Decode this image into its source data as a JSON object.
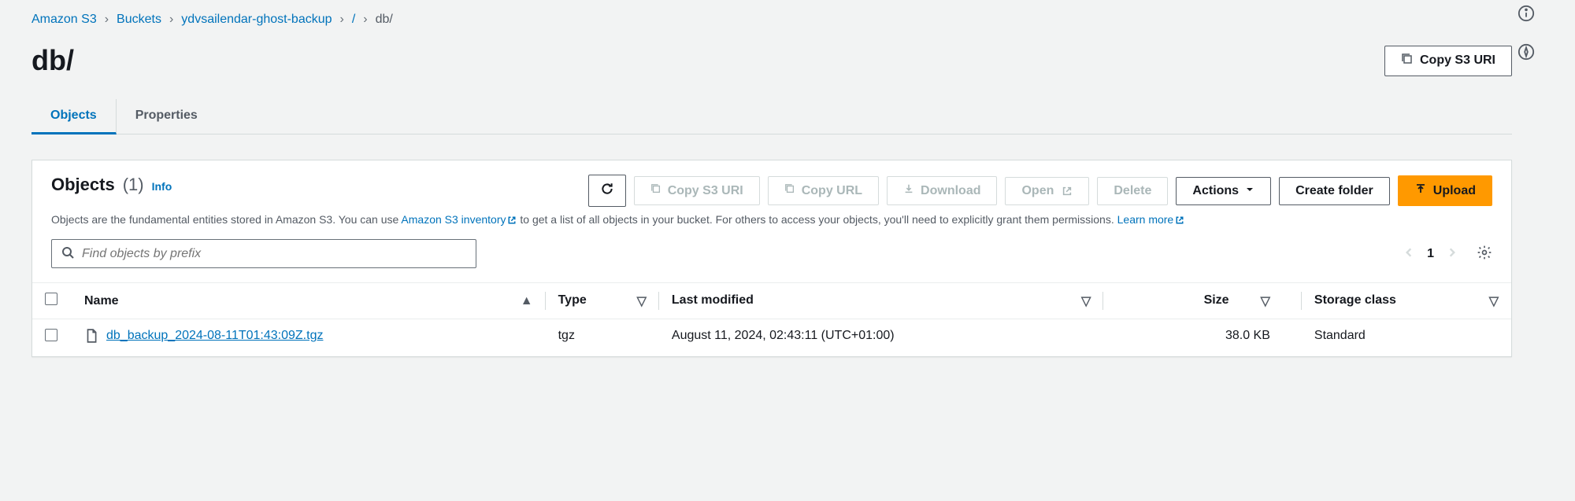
{
  "breadcrumb": {
    "root": "Amazon S3",
    "buckets": "Buckets",
    "bucket_name": "ydvsailendar-ghost-backup",
    "slash": "/",
    "current": "db/"
  },
  "page_title": "db/",
  "copy_uri_btn": "Copy S3 URI",
  "tabs": {
    "objects": "Objects",
    "properties": "Properties"
  },
  "panel": {
    "title": "Objects",
    "count": "(1)",
    "info": "Info",
    "desc_prefix": "Objects are the fundamental entities stored in Amazon S3. You can use ",
    "inventory_link": "Amazon S3 inventory",
    "desc_mid": " to get a list of all objects in your bucket. For others to access your objects, you'll need to explicitly grant them permissions. ",
    "learn_more": "Learn more"
  },
  "toolbar": {
    "copy_uri": "Copy S3 URI",
    "copy_url": "Copy URL",
    "download": "Download",
    "open": "Open",
    "delete": "Delete",
    "actions": "Actions",
    "create_folder": "Create folder",
    "upload": "Upload"
  },
  "search": {
    "placeholder": "Find objects by prefix"
  },
  "pagination": {
    "page": "1"
  },
  "columns": {
    "name": "Name",
    "type": "Type",
    "last_modified": "Last modified",
    "size": "Size",
    "storage_class": "Storage class"
  },
  "rows": [
    {
      "name": "db_backup_2024-08-11T01:43:09Z.tgz",
      "type": "tgz",
      "last_modified": "August 11, 2024, 02:43:11 (UTC+01:00)",
      "size": "38.0 KB",
      "storage_class": "Standard"
    }
  ]
}
